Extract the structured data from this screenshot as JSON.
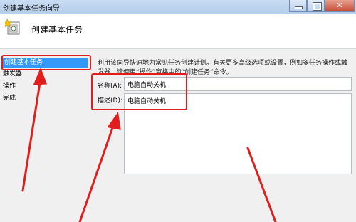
{
  "window": {
    "title": "创建基本任务向导",
    "close_glyph": "✕"
  },
  "header": {
    "title": "创建基本任务",
    "icon": "task-wizard-icon"
  },
  "sidebar": {
    "items": [
      {
        "label": "创建基本任务",
        "active": true
      },
      {
        "label": "触发器"
      },
      {
        "label": "操作"
      },
      {
        "label": "完成"
      }
    ]
  },
  "main": {
    "description": "利用该向导快速地为常见任务创建计划。有关更多高级选项或设置，例如多任务操作或触发器，请使用“操作”窗格中的“创建任务”命令。",
    "name_label": "名称(A):",
    "name_value": "电脑自动关机",
    "desc_label": "描述(D):",
    "desc_value": "电脑自动关机"
  },
  "annotation": {
    "color": "#e01e1e"
  }
}
